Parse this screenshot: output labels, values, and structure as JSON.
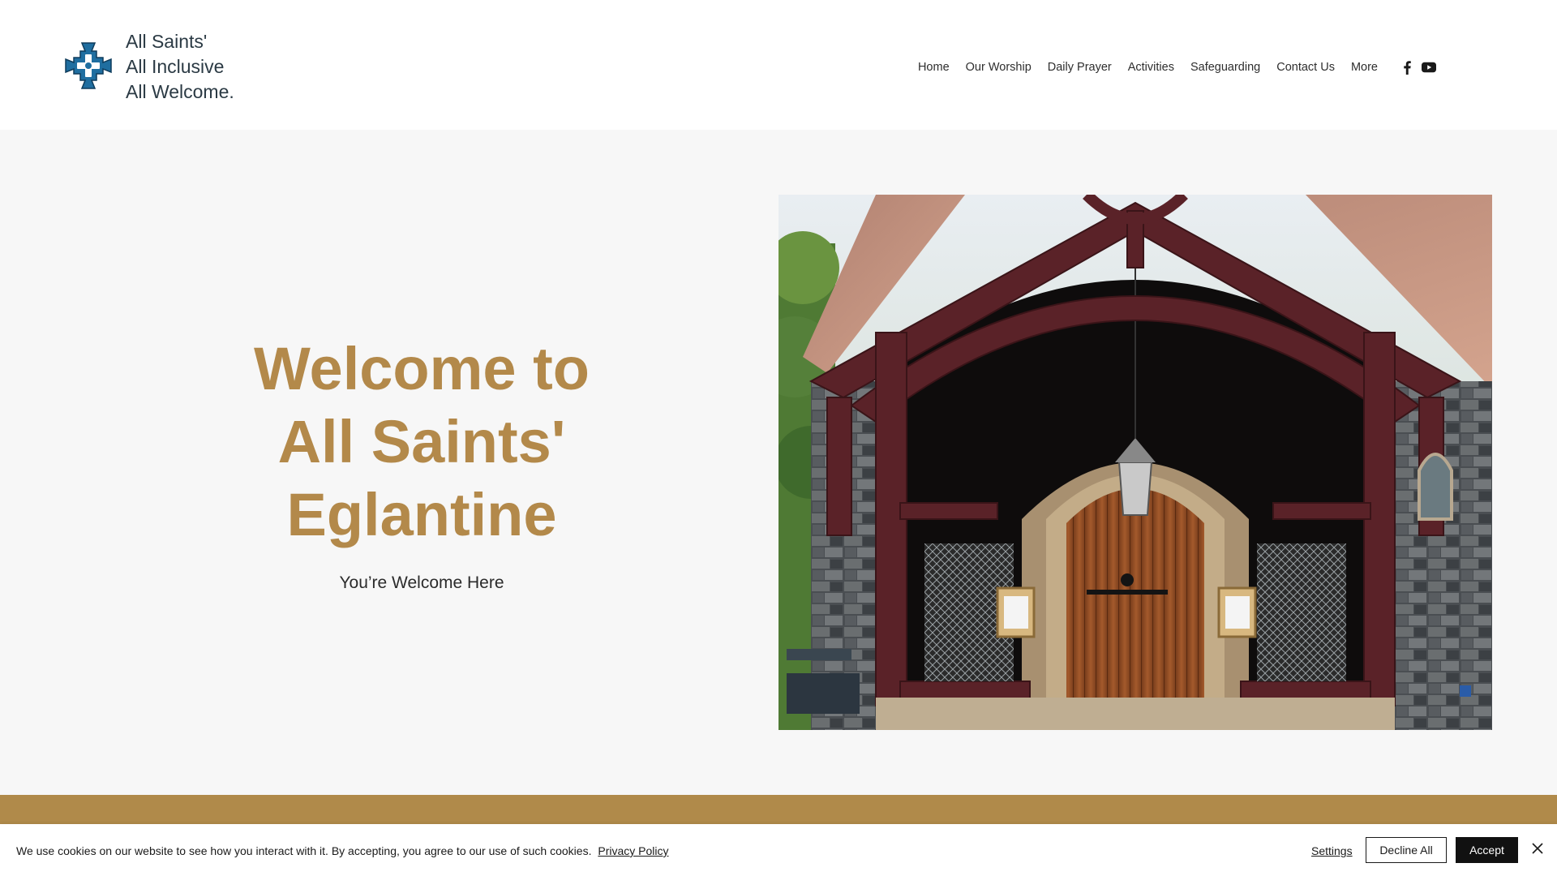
{
  "header": {
    "tagline": [
      "All Saints'",
      "All Inclusive",
      "All Welcome."
    ],
    "logo_icon": "celtic-cross-icon",
    "logo_color": "#1f6ea0",
    "nav": [
      {
        "label": "Home"
      },
      {
        "label": "Our Worship"
      },
      {
        "label": "Daily Prayer"
      },
      {
        "label": "Activities"
      },
      {
        "label": "Safeguarding"
      },
      {
        "label": "Contact Us"
      },
      {
        "label": "More"
      }
    ],
    "social": [
      "facebook-icon",
      "youtube-icon"
    ]
  },
  "hero": {
    "title_lines": [
      "Welcome to",
      "All Saints'",
      "Eglantine"
    ],
    "subtitle": "You’re Welcome Here",
    "title_color": "#b3894a",
    "photo": "church-porch-photo"
  },
  "cookie_banner": {
    "message": "We use cookies on our website to see how you interact with it. By accepting, you agree to our use of such cookies.",
    "privacy_link": "Privacy Policy",
    "settings_label": "Settings",
    "decline_label": "Decline All",
    "accept_label": "Accept"
  }
}
